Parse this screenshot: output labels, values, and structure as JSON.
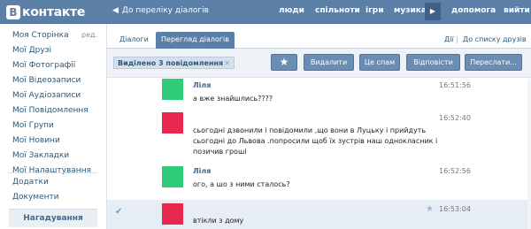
{
  "header": {
    "logo_letter": "В",
    "logo_text": "контакте",
    "back_link": "До переліку діалогів",
    "nav": [
      "люди",
      "спільноти",
      "ігри",
      "музика",
      "допомога",
      "вийти"
    ]
  },
  "sidebar": {
    "edit": "ред.",
    "items": [
      "Моя Сторінка",
      "Мої Друзі",
      "Мої Фотографії",
      "Мої Відеозаписи",
      "Мої Аудіозаписи",
      "Мої Повідомлення",
      "Мої Групи",
      "Мої Новини",
      "Мої Закладки",
      "Мої Налаштування"
    ],
    "extra": [
      "Додатки",
      "Документи"
    ],
    "reminder": "Нагадування"
  },
  "tabs": {
    "dialogs": "Діалоги",
    "view_dialog": "Перегляд діалогів",
    "actions": "Дії",
    "separator": "|",
    "friends_list": "До списку друзів"
  },
  "toolbar": {
    "selected": "Виділено 3 повідомлення",
    "delete": "Видалити",
    "spam": "Це спам",
    "reply": "Відповісти",
    "forward": "Переслати..."
  },
  "messages": [
    {
      "author": "Ліля",
      "text": "а вже знайшлись????",
      "time": "16:51:56",
      "avatar_color": "#2ecc7a",
      "selected": false
    },
    {
      "author": "",
      "text": "сьогодні дзвонили і повідомили ,що вони в Луцьку і прийдуть сьогодні до Львова .попросили щоб їх зустрів наш однокласник і позичив гроші",
      "time": "16:52:40",
      "avatar_color": "#e8274f",
      "selected": false
    },
    {
      "author": "Ліля",
      "text": "ого, а шо з ними сталось?",
      "time": "16:52:56",
      "avatar_color": "#2ecc7a",
      "selected": false
    },
    {
      "author": "",
      "text": "втікли з дому",
      "time": "16:53:04",
      "avatar_color": "#e8274f",
      "selected": true
    }
  ],
  "colors": {
    "brand": "#5b7fa6",
    "link": "#2b587a",
    "green_avatar": "#2ecc7a",
    "red_avatar": "#e8274f"
  }
}
